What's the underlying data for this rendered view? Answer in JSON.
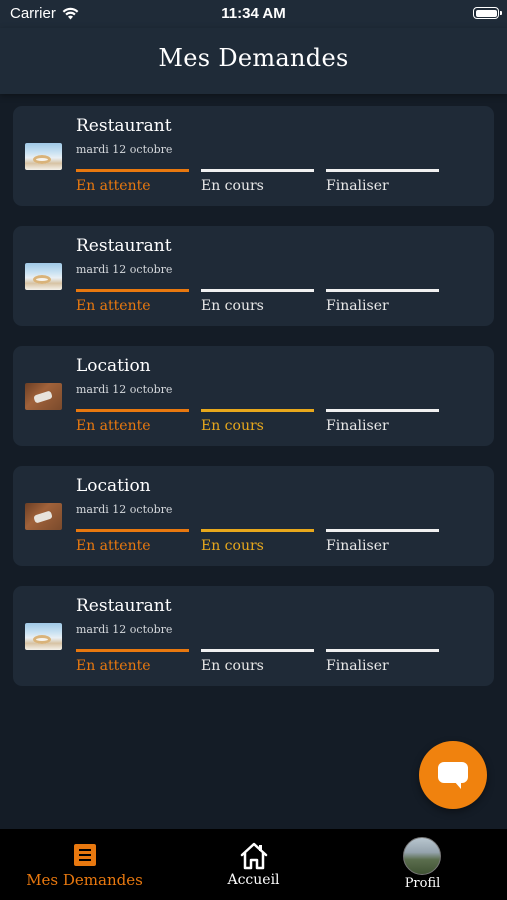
{
  "status_bar": {
    "carrier": "Carrier",
    "time": "11:34 AM"
  },
  "header": {
    "title": "Mes Demandes"
  },
  "cards": [
    {
      "title": "Restaurant",
      "date": "mardi 12 octobre",
      "image": "restaurant-photo",
      "steps": [
        "En attente",
        "En cours",
        "Finaliser"
      ],
      "step_colors": [
        "#e8780f",
        "#f0f0f0",
        "#f0f0f0"
      ]
    },
    {
      "title": "Restaurant",
      "date": "mardi 12 octobre",
      "image": "restaurant-photo",
      "steps": [
        "En attente",
        "En cours",
        "Finaliser"
      ],
      "step_colors": [
        "#e8780f",
        "#f0f0f0",
        "#f0f0f0"
      ]
    },
    {
      "title": "Location",
      "date": "mardi 12 octobre",
      "image": "location-photo",
      "steps": [
        "En attente",
        "En cours",
        "Finaliser"
      ],
      "step_colors": [
        "#e8780f",
        "#e8a81c",
        "#f0f0f0"
      ]
    },
    {
      "title": "Location",
      "date": "mardi 12 octobre",
      "image": "location-photo",
      "steps": [
        "En attente",
        "En cours",
        "Finaliser"
      ],
      "step_colors": [
        "#e8780f",
        "#e8a81c",
        "#f0f0f0"
      ]
    },
    {
      "title": "Restaurant",
      "date": "mardi 12 octobre",
      "image": "restaurant-photo",
      "steps": [
        "En attente",
        "En cours",
        "Finaliser"
      ],
      "step_colors": [
        "#e8780f",
        "#f0f0f0",
        "#f0f0f0"
      ]
    }
  ],
  "fab": {
    "icon": "chat-bubble-icon",
    "color": "#f0820e"
  },
  "tabbar": {
    "items": [
      {
        "label": "Mes Demandes",
        "icon": "document-list-icon",
        "active": true
      },
      {
        "label": "Accueil",
        "icon": "home-icon",
        "active": false
      },
      {
        "label": "Profil",
        "icon": "profile-avatar",
        "active": false
      }
    ]
  },
  "colors": {
    "accent": "#e8780f",
    "in_progress": "#e8a81c",
    "background": "#141c26",
    "card": "#1f2a37"
  }
}
